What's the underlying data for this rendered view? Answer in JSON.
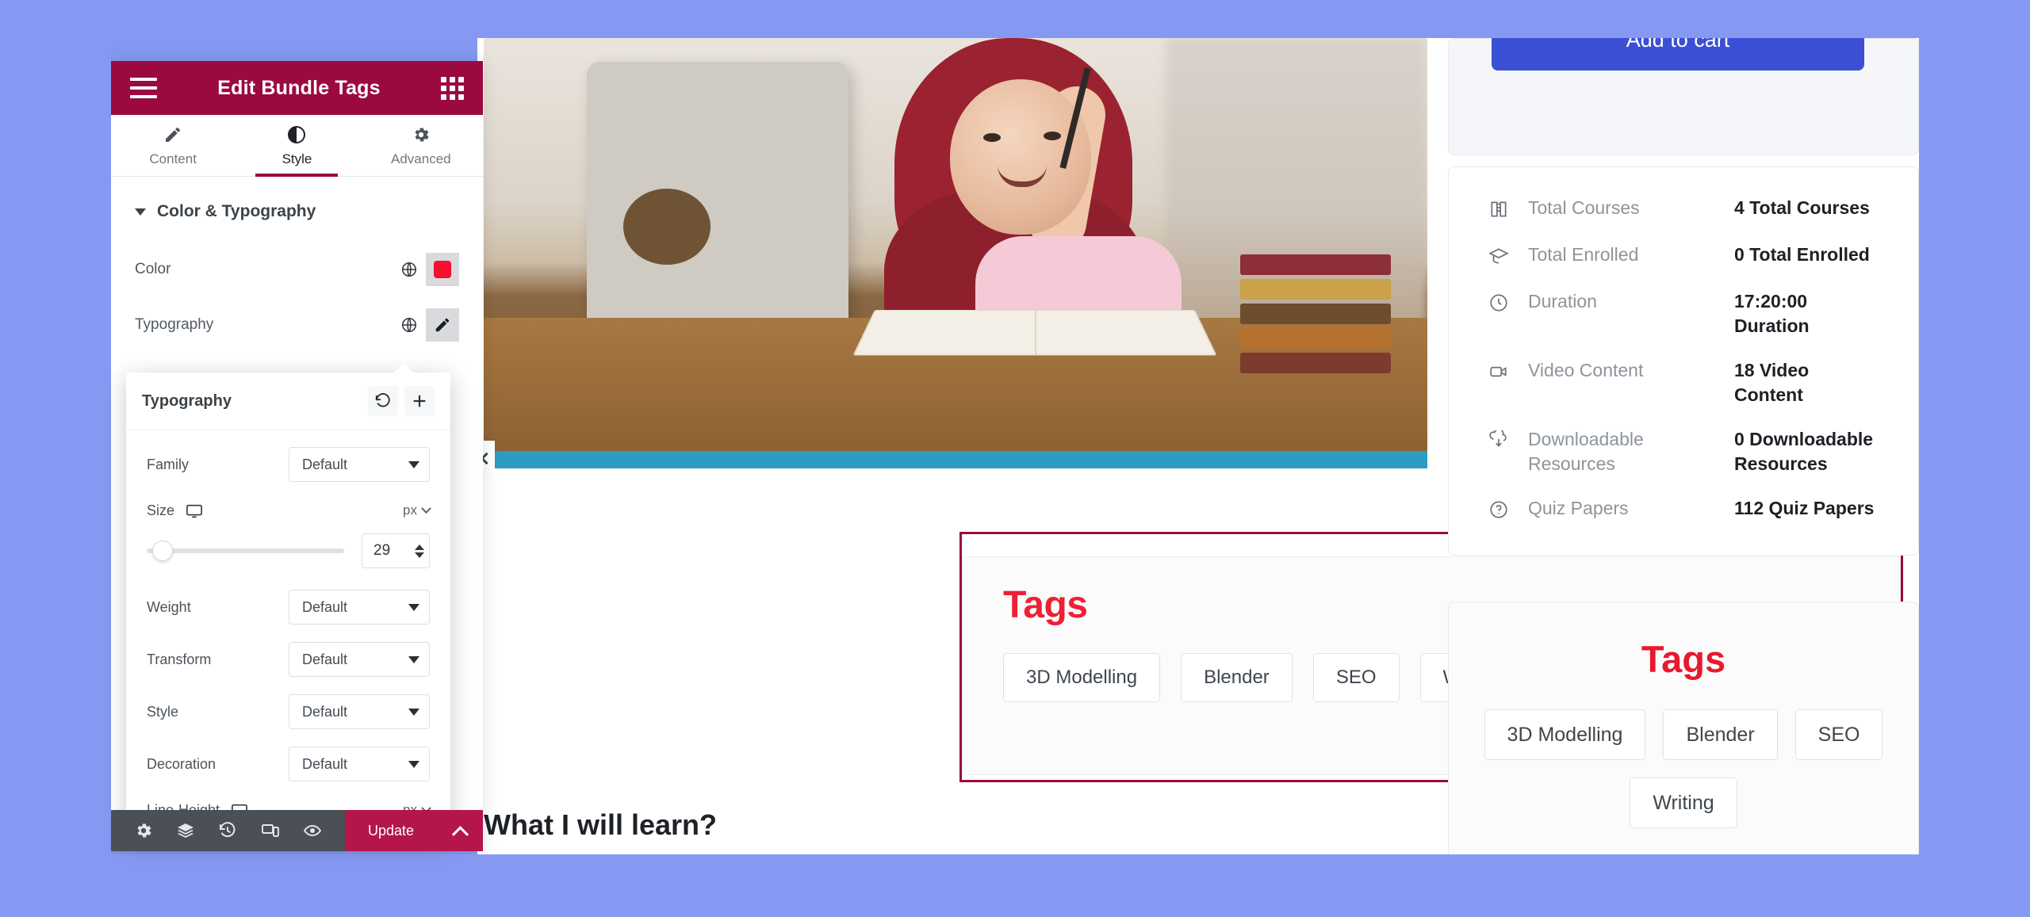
{
  "editor": {
    "title": "Edit Bundle Tags",
    "menu_icon": "hamburger-icon",
    "grid_icon": "app-grid-icon",
    "tabs": [
      {
        "label": "Content",
        "icon": "pencil-icon",
        "active": false
      },
      {
        "label": "Style",
        "icon": "contrast-icon",
        "active": true
      },
      {
        "label": "Advanced",
        "icon": "gear-icon",
        "active": false
      }
    ],
    "section": {
      "title": "Color & Typography",
      "expanded": true
    },
    "controls": [
      {
        "label": "Color",
        "type": "color",
        "swatch": "#f5102e",
        "globe": "globe-icon"
      },
      {
        "label": "Typography",
        "type": "typography",
        "globe": "globe-icon",
        "edit": "pencil-icon"
      }
    ],
    "footer": {
      "icons": [
        "gear-icon",
        "layers-icon",
        "history-icon",
        "responsive-icon",
        "eye-icon"
      ],
      "update_label": "Update",
      "caret": "chevron-up-icon"
    }
  },
  "typography_popover": {
    "title": "Typography",
    "reset_icon": "reset-icon",
    "add_icon": "plus-icon",
    "fields": [
      {
        "label": "Family",
        "value": "Default",
        "kind": "select"
      },
      {
        "label": "Size",
        "unit": "px",
        "value": "29",
        "kind": "slider",
        "device": "desktop-icon",
        "slider_percent": 8
      },
      {
        "label": "Weight",
        "value": "Default",
        "kind": "select"
      },
      {
        "label": "Transform",
        "value": "Default",
        "kind": "select"
      },
      {
        "label": "Style",
        "value": "Default",
        "kind": "select"
      },
      {
        "label": "Decoration",
        "value": "Default",
        "kind": "select"
      },
      {
        "label": "Line-Height",
        "unit": "px",
        "kind": "slider-partial",
        "device": "desktop-icon"
      }
    ]
  },
  "canvas": {
    "collapse_icon": "chevron-left-icon",
    "tags_widget": {
      "title": "Tags",
      "title_color": "#ef1f34",
      "chips": [
        "3D Modelling",
        "Blender",
        "SEO",
        "Writing"
      ]
    },
    "learn_heading": "What I will learn?"
  },
  "sidebar": {
    "cart_button": "Add to cart",
    "cart_button_color": "#3b50d4",
    "stats": [
      {
        "icon": "book-icon",
        "label": "Total Courses",
        "value": "4 Total Courses"
      },
      {
        "icon": "graduation-icon",
        "label": "Total Enrolled",
        "value": "0 Total Enrolled"
      },
      {
        "icon": "clock-icon",
        "label": "Duration",
        "value": "17:20:00 Duration"
      },
      {
        "icon": "video-icon",
        "label": "Video Content",
        "value": "18 Video Content"
      },
      {
        "icon": "download-icon",
        "label": "Downloadable Resources",
        "value": "0 Downloadable Resources"
      },
      {
        "icon": "question-icon",
        "label": "Quiz Papers",
        "value": "112 Quiz Papers"
      }
    ],
    "tags_card": {
      "title": "Tags",
      "title_color": "#e8192c",
      "chips": [
        "3D Modelling",
        "Blender",
        "SEO",
        "Writing"
      ]
    }
  },
  "theme": {
    "page_background": "#8699f2",
    "editor_header": "#9b0a3f",
    "accent": "#b4154b",
    "footer_bar": "#4a5055"
  }
}
